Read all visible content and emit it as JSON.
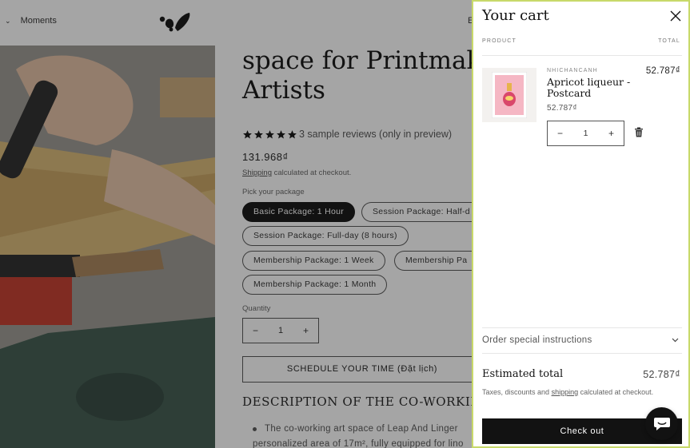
{
  "header": {
    "nav_label": "Moments",
    "edge_fragment": "E"
  },
  "product": {
    "title_line1": "space for Printmak",
    "title_line2": "Artists",
    "reviews_text": "3 sample reviews (only in preview)",
    "rating": 5,
    "price": "131.968₫",
    "shipping_link": "Shipping",
    "shipping_note": " calculated at checkout.",
    "pick_label": "Pick your package",
    "packages": [
      "Basic Package: 1 Hour",
      "Session Package: Half-d",
      "Session Package: Full-day (8 hours)",
      "Membership Package: 1 Week",
      "Membership Pa",
      "Membership Package: 1 Month"
    ],
    "selected_package": "Basic Package: 1 Hour",
    "quantity_label": "Quantity",
    "quantity": "1",
    "schedule_button": "SCHEDULE YOUR TIME (Đặt lịch)",
    "description_title": "DESCRIPTION OF THE CO-WORKING",
    "description_line1": "The co-working art space of Leap And Linger",
    "description_line2": "personalized area of 17m², fully equipped for lino"
  },
  "cart": {
    "title": "Your cart",
    "col_product": "PRODUCT",
    "col_total": "TOTAL",
    "item": {
      "vendor": "NHICHANCANH",
      "title": "Apricot liqueur - Postcard",
      "price": "52.787₫",
      "line_total": "52.787₫",
      "quantity": "1"
    },
    "instructions_label": "Order special instructions",
    "estimated_label": "Estimated total",
    "estimated_value": "52.787₫",
    "tax_note_before": "Taxes, discounts and ",
    "tax_note_link": "shipping",
    "tax_note_after": " calculated at checkout.",
    "checkout_label": "Check out"
  },
  "colors": {
    "primary": "#121212",
    "drawer_outline": "#c8d96a",
    "overlay": "rgba(18,18,18,0.38)"
  },
  "icons": [
    "chevron-down-icon",
    "logo-mark",
    "star-icon",
    "close-icon",
    "minus-icon",
    "plus-icon",
    "trash-icon",
    "chat-icon"
  ]
}
